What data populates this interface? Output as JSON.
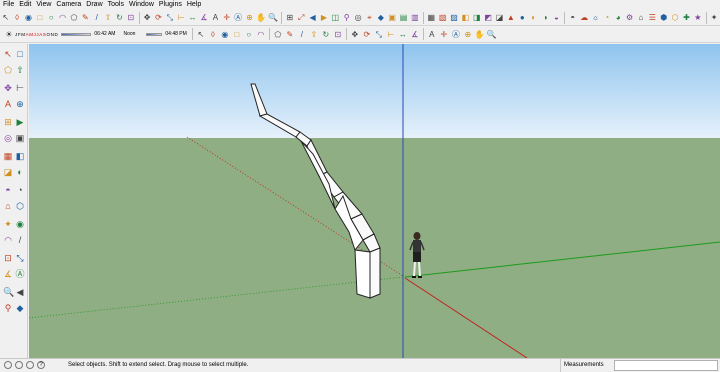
{
  "menu": [
    "File",
    "Edit",
    "View",
    "Camera",
    "Draw",
    "Tools",
    "Window",
    "Plugins",
    "Help"
  ],
  "shadow": {
    "months": [
      "J",
      "F",
      "M",
      "A",
      "M",
      "J",
      "J",
      "A",
      "S",
      "O",
      "N",
      "D"
    ],
    "time_start": "06:42 AM",
    "noon": "Noon",
    "time_end": "04:48 PM"
  },
  "status": {
    "message": "Select objects. Shift to extend select. Drag mouse to select multiple.",
    "measurements_label": "Measurements",
    "measurements_value": ""
  },
  "icons": {
    "toolbar1": [
      "select",
      "eraser",
      "paint",
      "rectangle",
      "circle",
      "arc",
      "polygon",
      "freehand",
      "line",
      "push-pull",
      "follow-me",
      "offset",
      "move",
      "rotate",
      "scale",
      "tape",
      "dimension",
      "protractor",
      "text",
      "axes",
      "3d-text",
      "orbit",
      "pan",
      "zoom",
      "zoom-window",
      "zoom-extents",
      "previous",
      "next",
      "section",
      "walk",
      "look",
      "position-camera",
      "iso",
      "top",
      "front",
      "right",
      "back",
      "left",
      "bottom",
      "xray",
      "wireframe",
      "hidden-line",
      "shaded",
      "textured",
      "monochrome",
      "components",
      "materials",
      "styles",
      "layers",
      "outliner",
      "scenes",
      "shadows",
      "fog",
      "match-photo",
      "soften",
      "geo-location",
      "photo-texture",
      "warehouse",
      "share",
      "extension",
      "layout"
    ],
    "toolbar2": [
      "new",
      "open",
      "save",
      "cut",
      "copy",
      "paste",
      "erase",
      "undo",
      "redo",
      "print",
      "model-info",
      "make-component",
      "sandbox",
      "union",
      "subtract",
      "intersect",
      "trim",
      "split",
      "outer-shell",
      "add-location",
      "toggle-terrain",
      "get-models",
      "share-model",
      "solid-tools"
    ],
    "left": [
      "select-arrow",
      "make-component",
      "paint-bucket",
      "eraser",
      "rectangle",
      "line",
      "circle",
      "arc",
      "polygon",
      "freehand",
      "move",
      "push-pull",
      "rotate",
      "follow-me",
      "scale",
      "offset",
      "tape-measure",
      "dimension",
      "protractor",
      "text",
      "axes",
      "3d-text",
      "orbit",
      "pan",
      "zoom",
      "zoom-window",
      "zoom-extents",
      "previous",
      "walk",
      "look",
      "position-camera",
      "section-plane"
    ]
  },
  "colors": {
    "sky_top": "#8fc4ee",
    "sky_bottom": "#e6f1fb",
    "ground": "#8fae83",
    "axis_blue": "#2a48b8",
    "axis_green": "#1d9a1d",
    "axis_red": "#c02020"
  }
}
